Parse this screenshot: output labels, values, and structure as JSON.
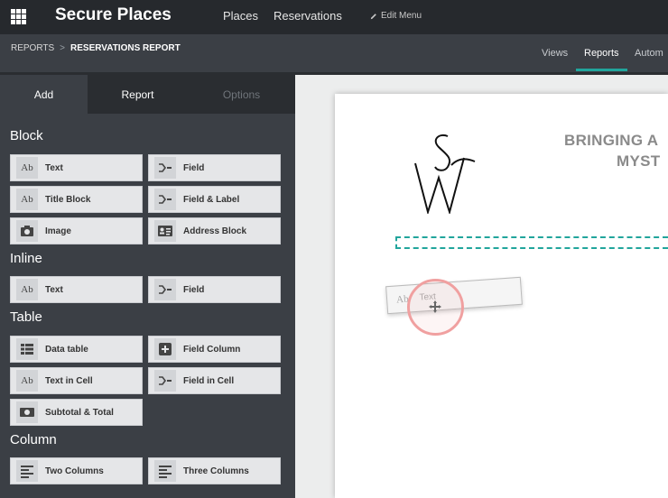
{
  "app": {
    "title": "Secure Places",
    "menu": [
      "Places",
      "Reservations"
    ],
    "edit_menu": "Edit Menu"
  },
  "breadcrumb": {
    "root": "REPORTS",
    "separator": ">",
    "current": "RESERVATIONS REPORT"
  },
  "view_tabs": [
    "Views",
    "Reports",
    "Autom"
  ],
  "sidebar": {
    "tabs": [
      "Add",
      "Report",
      "Options"
    ],
    "sections": {
      "block": {
        "title": "Block",
        "items": [
          "Text",
          "Field",
          "Title Block",
          "Field & Label",
          "Image",
          "Address Block"
        ]
      },
      "inline": {
        "title": "Inline",
        "items": [
          "Text",
          "Field"
        ]
      },
      "table": {
        "title": "Table",
        "items": [
          "Data table",
          "Field Column",
          "Text in Cell",
          "Field in Cell",
          "Subtotal & Total"
        ]
      },
      "column": {
        "title": "Column",
        "items": [
          "Two Columns",
          "Three Columns"
        ]
      }
    },
    "icon_text": "Ab"
  },
  "canvas": {
    "headline_line1": "BRINGING A",
    "headline_line2": "MYST",
    "drag_ghost": {
      "icon_text": "Ab",
      "label": "Text"
    }
  },
  "colors": {
    "accent": "#21a59c",
    "topbar": "#26292d",
    "sidebar": "#3b3f45",
    "cursor_ring": "#f0a0a0"
  }
}
